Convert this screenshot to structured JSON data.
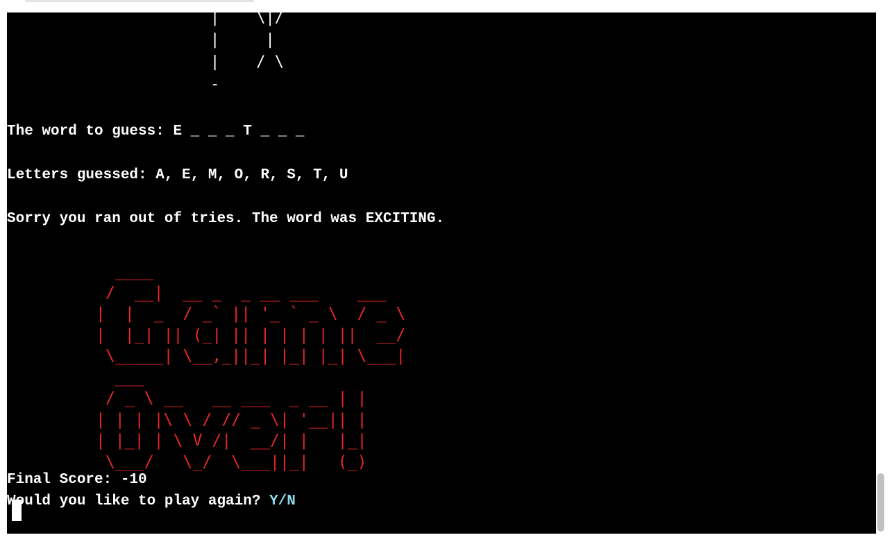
{
  "terminal": {
    "hangman_art": "|    \\|/\n|     |\n|    / \\\n-",
    "word_line": "The word to guess: E _ _ _ T _ _ _",
    "guessed_line": "Letters guessed: A, E, M, O, R, S, T, U",
    "sorry_prefix": "Sorry you ran out of tries. The word was ",
    "secret_word": "EXCITING",
    "sorry_suffix": ".",
    "game_over_art": "  ____\n /  __|  __ _  _ __ ___    ___\n|  |  _  / _` || '_ ` _ \\  / _ \\\n|  |_| || (_| || | | | | ||  __/\n \\_____| \\__,_||_| |_| |_| \\___|\n  ___\n / _ \\ __   __ ___  _ __ | |\n| | | |\\ \\ / // _ \\| '__|| |\n| |_| | \\ V /|  __/| |   |_|\n \\___/   \\_/  \\___||_|   (_)",
    "final_score": "Final Score: -10",
    "play_again_prompt": "Would you like to play again? ",
    "play_again_options": "Y/N",
    "colors": {
      "background": "#000000",
      "text": "#ffffff",
      "game_over": "#e8262a",
      "options": "#8fdcf0"
    }
  }
}
